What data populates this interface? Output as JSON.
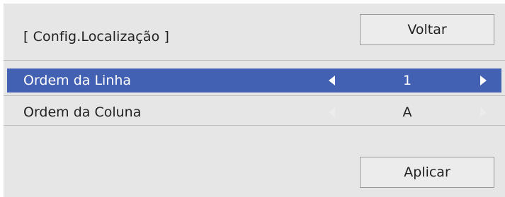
{
  "header": {
    "title": "[ Config.Localização ]",
    "back_label": "Voltar"
  },
  "settings": {
    "rows": [
      {
        "label": "Ordem da Linha",
        "value": "1",
        "selected": true
      },
      {
        "label": "Ordem da Coluna",
        "value": "A",
        "selected": false
      }
    ]
  },
  "footer": {
    "apply_label": "Aplicar"
  },
  "icons": {
    "left": "arrow-left-icon",
    "right": "arrow-right-icon"
  },
  "colors": {
    "panel_bg": "#e6e6e6",
    "selected_row": "#4361b3",
    "button_bg": "#ececec",
    "text": "#222222"
  }
}
